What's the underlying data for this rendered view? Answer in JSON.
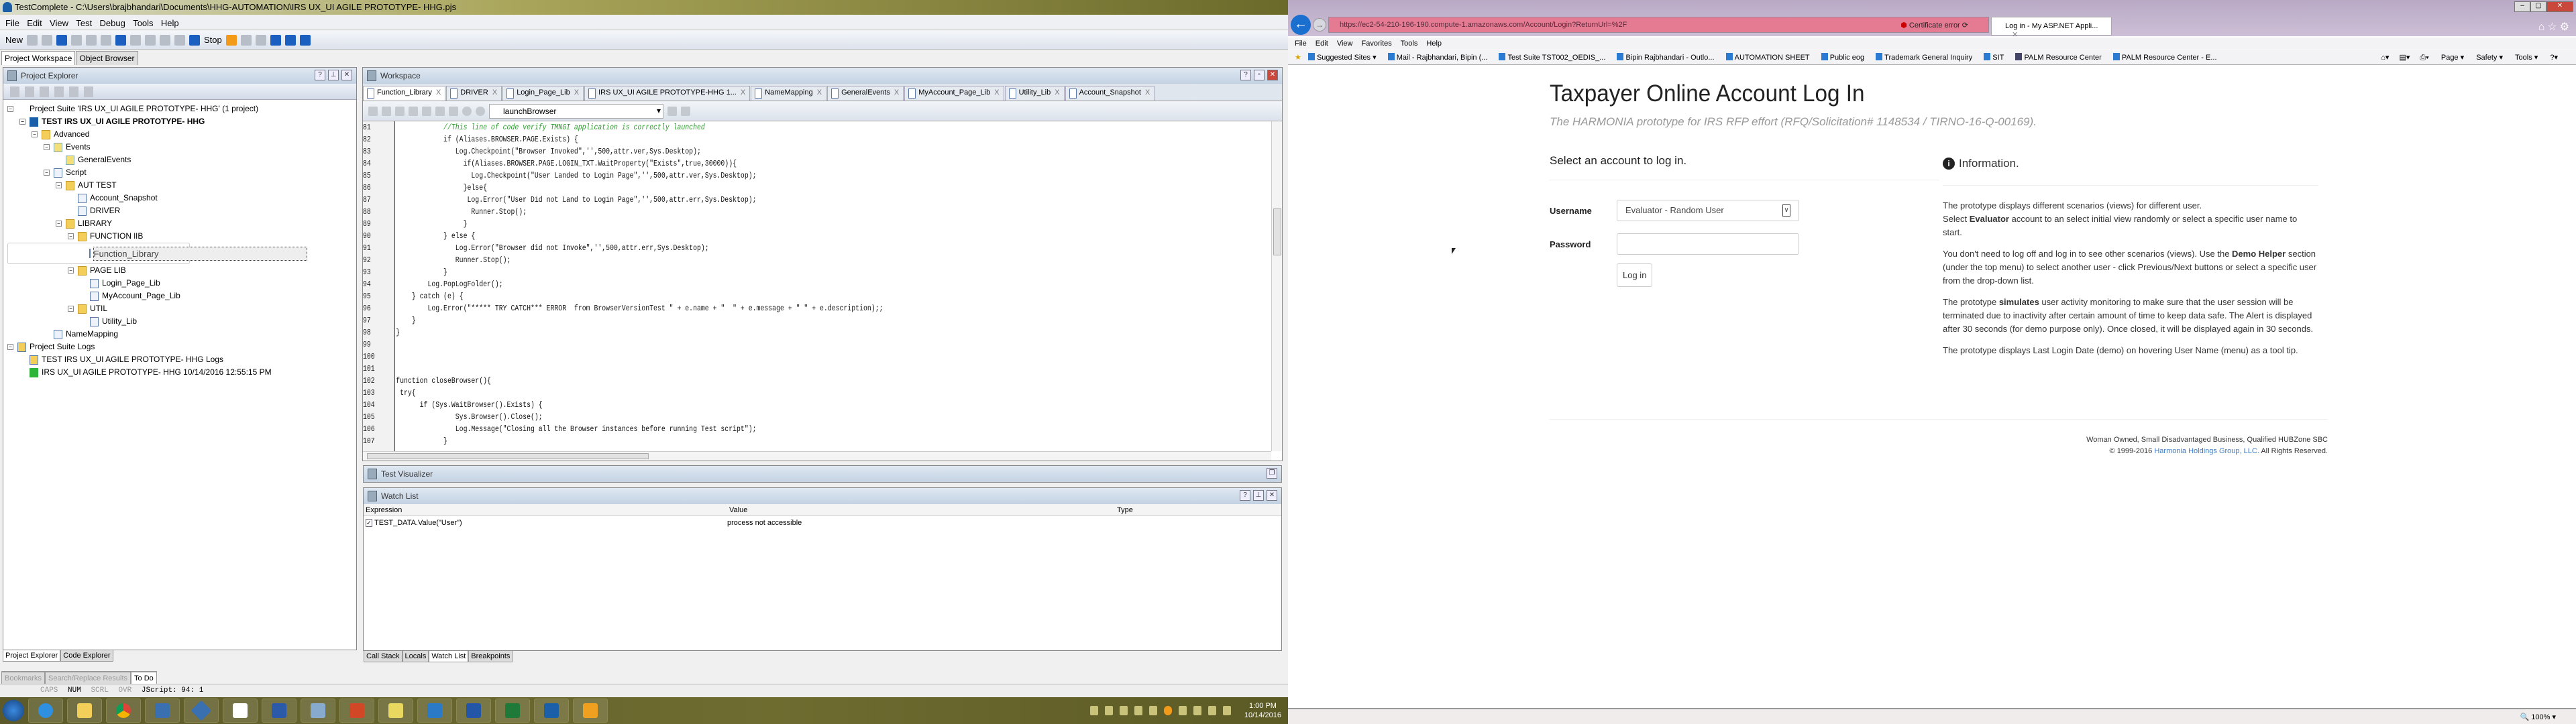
{
  "testcomplete": {
    "title": "TestComplete - C:\\Users\\brajbhandari\\Documents\\HHG-AUTOMATION\\IRS UX_UI AGILE PROTOTYPE- HHG.pjs",
    "menu": [
      "File",
      "Edit",
      "View",
      "Test",
      "Debug",
      "Tools",
      "Help"
    ],
    "toolbar": {
      "new_label": "New",
      "stop_label": "Stop"
    },
    "workspace_tabs": [
      "Project Workspace",
      "Object Browser"
    ],
    "project_explorer": {
      "title": "Project Explorer",
      "tree": [
        {
          "label": "Project Suite 'IRS UX_UI AGILE PROTOTYPE- HHG' (1 project)",
          "level": 0,
          "icon": "suite"
        },
        {
          "label": "TEST IRS UX_UI AGILE PROTOTYPE- HHG",
          "level": 1,
          "icon": "proj",
          "bold": true
        },
        {
          "label": "Advanced",
          "level": 2,
          "icon": "folder"
        },
        {
          "label": "Events",
          "level": 3,
          "icon": "ev"
        },
        {
          "label": "GeneralEvents",
          "level": 4,
          "icon": "ev"
        },
        {
          "label": "Script",
          "level": 3,
          "icon": "doc"
        },
        {
          "label": "AUT TEST",
          "level": 4,
          "icon": "folder"
        },
        {
          "label": "Account_Snapshot",
          "level": 5,
          "icon": "doc"
        },
        {
          "label": "DRIVER",
          "level": 5,
          "icon": "doc"
        },
        {
          "label": "LIBRARY",
          "level": 4,
          "icon": "folder"
        },
        {
          "label": "FUNCTION lIB",
          "level": 5,
          "icon": "folder"
        },
        {
          "label": "Function_Library",
          "level": 6,
          "icon": "doc",
          "selected": true
        },
        {
          "label": "PAGE LIB",
          "level": 5,
          "icon": "folder"
        },
        {
          "label": "Login_Page_Lib",
          "level": 6,
          "icon": "doc"
        },
        {
          "label": "MyAccount_Page_Lib",
          "level": 6,
          "icon": "doc"
        },
        {
          "label": "UTIL",
          "level": 5,
          "icon": "folder"
        },
        {
          "label": "Utility_Lib",
          "level": 6,
          "icon": "doc"
        },
        {
          "label": "NameMapping",
          "level": 3,
          "icon": "doc"
        },
        {
          "label": "Project Suite Logs",
          "level": 0,
          "icon": "log"
        },
        {
          "label": "TEST IRS UX_UI AGILE PROTOTYPE- HHG Logs",
          "level": 1,
          "icon": "log"
        },
        {
          "label": "IRS UX_UI AGILE PROTOTYPE- HHG 10/14/2016 12:55:15 PM",
          "level": 1,
          "icon": "ok"
        }
      ],
      "bottom_tabs": [
        "Project Explorer",
        "Code Explorer"
      ]
    },
    "workspace": {
      "title": "Workspace",
      "tabs": [
        "Function_Library",
        "DRIVER",
        "Login_Page_Lib",
        "IRS UX_UI AGILE PROTOTYPE-HHG 1...",
        "NameMapping",
        "GeneralEvents",
        "MyAccount_Page_Lib",
        "Utility_Lib",
        "Account_Snapshot"
      ],
      "routine": "launchBrowser",
      "code": [
        {
          "n": "81",
          "t": "            //This line of code verify TMNGI application is correctly launched",
          "c": "comment"
        },
        {
          "n": "82",
          "t": "            if (Aliases.BROWSER.PAGE.Exists) {"
        },
        {
          "n": "83",
          "t": "               Log.Checkpoint(\"Browser Invoked\",'',500,attr.ver,Sys.Desktop);"
        },
        {
          "n": "84",
          "t": "                 if(Aliases.BROWSER.PAGE.LOGIN_TXT.WaitProperty(\"Exists\",true,30000)){"
        },
        {
          "n": "85",
          "t": "                   Log.Checkpoint(\"User Landed to Login Page\",'',500,attr.ver,Sys.Desktop);"
        },
        {
          "n": "86",
          "t": "                 }else{"
        },
        {
          "n": "87",
          "t": "                  Log.Error(\"User Did not Land to Login Page\",'',500,attr.err,Sys.Desktop);"
        },
        {
          "n": "88",
          "t": "                   Runner.Stop();"
        },
        {
          "n": "89",
          "t": "                 }"
        },
        {
          "n": "90",
          "t": "            } else {"
        },
        {
          "n": "91",
          "t": "               Log.Error(\"Browser did not Invoke\",'',500,attr.err,Sys.Desktop);"
        },
        {
          "n": "92",
          "t": "               Runner.Stop();"
        },
        {
          "n": "93",
          "t": "            }"
        },
        {
          "n": "94",
          "t": "        Log.PopLogFolder();"
        },
        {
          "n": "95",
          "t": "    } catch (e) {"
        },
        {
          "n": "96",
          "t": "        Log.Error(\"***** TRY CATCH*** ERROR  from BrowserVersionTest \" + e.name + \"  \" + e.message + \" \" + e.description);;"
        },
        {
          "n": "97",
          "t": "    }"
        },
        {
          "n": "98",
          "t": "}"
        },
        {
          "n": "99",
          "t": ""
        },
        {
          "n": "100",
          "t": ""
        },
        {
          "n": "101",
          "t": ""
        },
        {
          "n": "102",
          "t": "function closeBrowser(){"
        },
        {
          "n": "103",
          "t": " try{"
        },
        {
          "n": "104",
          "t": "      if (Sys.WaitBrowser().Exists) {"
        },
        {
          "n": "105",
          "t": "               Sys.Browser().Close();"
        },
        {
          "n": "106",
          "t": "               Log.Message(\"Closing all the Browser instances before running Test script\");"
        },
        {
          "n": "107",
          "t": "            }"
        }
      ]
    },
    "test_visualizer": {
      "title": "Test Visualizer"
    },
    "watch_list": {
      "title": "Watch List",
      "columns": [
        "Expression",
        "Value",
        "Type"
      ],
      "rows": [
        {
          "expression": "TEST_DATA.Value(\"User\")",
          "value": "process not accessible",
          "type": "",
          "checked": true
        }
      ],
      "bottom_tabs": [
        "Call Stack",
        "Locals",
        "Watch List",
        "Breakpoints"
      ]
    },
    "bottom_tabs": [
      "Bookmarks",
      "Search/Replace Results",
      "To Do"
    ],
    "status": {
      "caps": "CAPS",
      "num": "NUM",
      "scrl": "SCRL",
      "ovr": "OVR",
      "position": "JScript:  94:  1"
    }
  },
  "taskbar": {
    "time": "1:00 PM",
    "date": "10/14/2016"
  },
  "browser": {
    "url": "https://ec2-54-210-196-190.compute-1.amazonaws.com/Account/Login?ReturnUrl=%2F",
    "cert_error": "Certificate error",
    "tab_title": "Log in - My ASP.NET Appli...",
    "menu": [
      "File",
      "Edit",
      "View",
      "Favorites",
      "Tools",
      "Help"
    ],
    "favorites": [
      "Suggested Sites ▾",
      "Mail - Rajbhandari, Bipin (...",
      "Test Suite TST002_OEDIS_...",
      "Bipin Rajbhandari - Outlo...",
      "AUTOMATION SHEET",
      "Public eog",
      "Trademark General Inquiry",
      "SIT",
      "PALM Resource Center",
      "PALM Resource Center - E..."
    ],
    "command_bar": [
      "Page ▾",
      "Safety ▾",
      "Tools ▾"
    ],
    "zoom": "100%"
  },
  "page": {
    "title": "Taxpayer Online Account Log In",
    "subtitle": "The HARMONIA prototype for IRS RFP effort (RFQ/Solicitation# 1148534 / TIRNO-16-Q-00169).",
    "login_heading": "Select an account to log in.",
    "username_label": "Username",
    "username_value": "Evaluator - Random User",
    "password_label": "Password",
    "login_button": "Log in",
    "info_heading": "Information.",
    "info": {
      "p1a": "The prototype displays different scenarios (views) for different user.",
      "p1b": "Select ",
      "p1bold": "Evaluator",
      "p1c": " account to an select initial view randomly or select a specific user name to start.",
      "p2a": "You don't need to log off and log in to see other scenarios (views). Use the ",
      "p2bold": "Demo Helper",
      "p2b": " section (under the top menu) to select another user - click Previous/Next buttons or select a specific user from the drop-down list.",
      "p3a": "The prototype ",
      "p3bold": "simulates",
      "p3b": " user activity monitoring to make sure that the user session will be terminated due to inactivity after certain amount of time to keep data safe. The Alert is displayed after 30 seconds (for demo purpose only). Once closed, it will be displayed again in 30 seconds.",
      "p4": "The prototype displays Last Login Date (demo) on hovering User Name (menu) as a tool tip."
    },
    "footer_line1": "Woman Owned, Small Disadvantaged Business, Qualified HUBZone SBC",
    "footer_copy": "© 1999-2016 ",
    "footer_link": "Harmonia Holdings Group, LLC.",
    "footer_rights": " All Rights Reserved."
  }
}
